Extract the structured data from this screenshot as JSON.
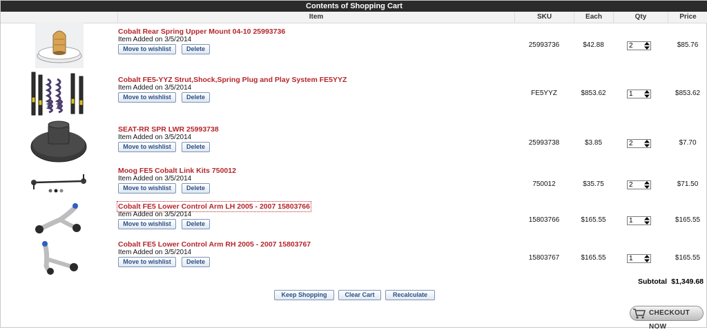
{
  "cart": {
    "title": "Contents of Shopping Cart",
    "columns": {
      "item": "Item",
      "sku": "SKU",
      "each": "Each",
      "qty": "Qty",
      "price": "Price"
    },
    "move_label": "Move to wishlist",
    "delete_label": "Delete",
    "items": [
      {
        "name": "Cobalt Rear Spring Upper Mount 04-10 25993736",
        "added": "Item Added on 3/5/2014",
        "sku": "25993736",
        "each": "$42.88",
        "qty": "2",
        "price": "$85.76",
        "image": "spring-mount-image"
      },
      {
        "name": "Cobalt FE5-YYZ Strut,Shock,Spring Plug and Play System FE5YYZ",
        "added": "Item Added on 3/5/2014",
        "sku": "FE5YYZ",
        "each": "$853.62",
        "qty": "1",
        "price": "$853.62",
        "image": "coilover-kit-image"
      },
      {
        "name": "SEAT-RR SPR LWR 25993738",
        "added": "Item Added on 3/5/2014",
        "sku": "25993738",
        "each": "$3.85",
        "qty": "2",
        "price": "$7.70",
        "image": "spring-seat-image"
      },
      {
        "name": "Moog FE5 Cobalt Link Kits 750012",
        "added": "Item Added on 3/5/2014",
        "sku": "750012",
        "each": "$35.75",
        "qty": "2",
        "price": "$71.50",
        "image": "sway-bar-link-image"
      },
      {
        "name": "Cobalt FE5 Lower Control Arm LH 2005 - 2007 15803766",
        "added": "Item Added on 3/5/2014",
        "sku": "15803766",
        "each": "$165.55",
        "qty": "1",
        "price": "$165.55",
        "image": "control-arm-lh-image"
      },
      {
        "name": "Cobalt FE5 Lower Control Arm RH 2005 - 2007 15803767",
        "added": "Item Added on 3/5/2014",
        "sku": "15803767",
        "each": "$165.55",
        "qty": "1",
        "price": "$165.55",
        "image": "control-arm-rh-image"
      }
    ],
    "subtotal_label": "Subtotal",
    "subtotal_value": "$1,349.68",
    "buttons": {
      "keep_shopping": "Keep Shopping",
      "clear_cart": "Clear Cart",
      "recalculate": "Recalculate"
    },
    "checkout_label": "CHECKOUT NOW",
    "colors": {
      "title_bar": "#2b2b2b",
      "item_link": "#b5252b",
      "button_text": "#2a4f86",
      "button_border": "#7b93b5"
    }
  }
}
